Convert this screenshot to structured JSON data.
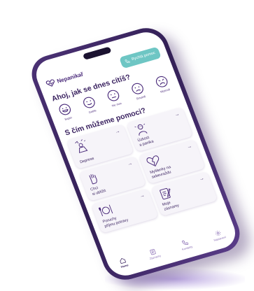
{
  "app": {
    "name": "Nepanikař"
  },
  "header": {
    "help_button": "Rychlá pomoc"
  },
  "greeting": "Ahoj, jak se dnes cítíš?",
  "moods": [
    {
      "label": "Super",
      "icon": "very-happy-face-icon"
    },
    {
      "label": "Dobře",
      "icon": "smile-face-icon"
    },
    {
      "label": "Nic moc",
      "icon": "neutral-face-icon"
    },
    {
      "label": "Smutně",
      "icon": "sad-face-icon"
    },
    {
      "label": "Mizerně",
      "icon": "miserable-face-icon"
    }
  ],
  "help_section": {
    "title": "S čím můžeme pomoci?",
    "cards": [
      {
        "label": "Deprese",
        "icon": "depression-illustration"
      },
      {
        "label": "Úzkost\na panika",
        "icon": "anxiety-illustration"
      },
      {
        "label": "Chci\nsi ublížit",
        "icon": "hand-illustration"
      },
      {
        "label": "Myšlenky na\nsebevraždu",
        "icon": "broken-heart-illustration"
      },
      {
        "label": "Poruchy\npříjmu potravy",
        "icon": "plate-illustration"
      },
      {
        "label": "Moje\nzáznamy",
        "icon": "journal-illustration"
      }
    ]
  },
  "bottom_nav": [
    {
      "label": "Home",
      "icon": "home-icon",
      "active": true
    },
    {
      "label": "Záznamy",
      "icon": "notes-icon",
      "active": false
    },
    {
      "label": "Kontakty",
      "icon": "phone-icon",
      "active": false
    },
    {
      "label": "Nastavení",
      "icon": "gear-icon",
      "active": false
    }
  ],
  "colors": {
    "brand": "#4a2a7a",
    "accent": "#6ec6c4",
    "frame": "#3e2766"
  }
}
